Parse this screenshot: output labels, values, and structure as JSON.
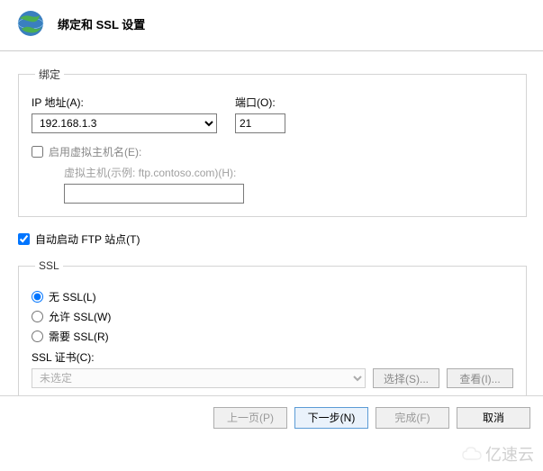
{
  "header": {
    "title": "绑定和 SSL 设置"
  },
  "binding": {
    "legend": "绑定",
    "ip_label": "IP 地址(A):",
    "ip_value": "192.168.1.3",
    "port_label": "端口(O):",
    "port_value": "21",
    "enable_vhost_label": "启用虚拟主机名(E):",
    "enable_vhost_checked": false,
    "vhost_hint": "虚拟主机(示例: ftp.contoso.com)(H):",
    "vhost_value": ""
  },
  "autostart": {
    "label": "自动启动 FTP 站点(T)",
    "checked": true
  },
  "ssl": {
    "legend": "SSL",
    "options": {
      "none": "无 SSL(L)",
      "allow": "允许 SSL(W)",
      "require": "需要 SSL(R)"
    },
    "selected": "none",
    "cert_label": "SSL 证书(C):",
    "cert_value": "未选定",
    "select_btn": "选择(S)...",
    "view_btn": "查看(I)..."
  },
  "footer": {
    "prev": "上一页(P)",
    "next": "下一步(N)",
    "finish": "完成(F)",
    "cancel": "取消"
  },
  "watermark": "亿速云"
}
